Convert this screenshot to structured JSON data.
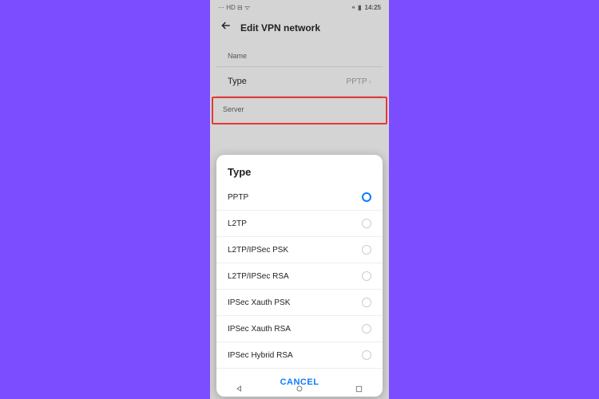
{
  "statusbar": {
    "left": "⋯ HD ⊟ ᯤ",
    "battery": "⚬ ▮",
    "time": "14:25"
  },
  "header": {
    "title": "Edit VPN network"
  },
  "fields": {
    "name_label": "Name",
    "type_label": "Type",
    "type_value": "PPTP",
    "server_label": "Server"
  },
  "modal": {
    "title": "Type",
    "options": [
      {
        "label": "PPTP",
        "selected": true
      },
      {
        "label": "L2TP",
        "selected": false
      },
      {
        "label": "L2TP/IPSec PSK",
        "selected": false
      },
      {
        "label": "L2TP/IPSec RSA",
        "selected": false
      },
      {
        "label": "IPSec Xauth PSK",
        "selected": false
      },
      {
        "label": "IPSec Xauth RSA",
        "selected": false
      },
      {
        "label": "IPSec Hybrid RSA",
        "selected": false
      }
    ],
    "cancel": "CANCEL"
  }
}
